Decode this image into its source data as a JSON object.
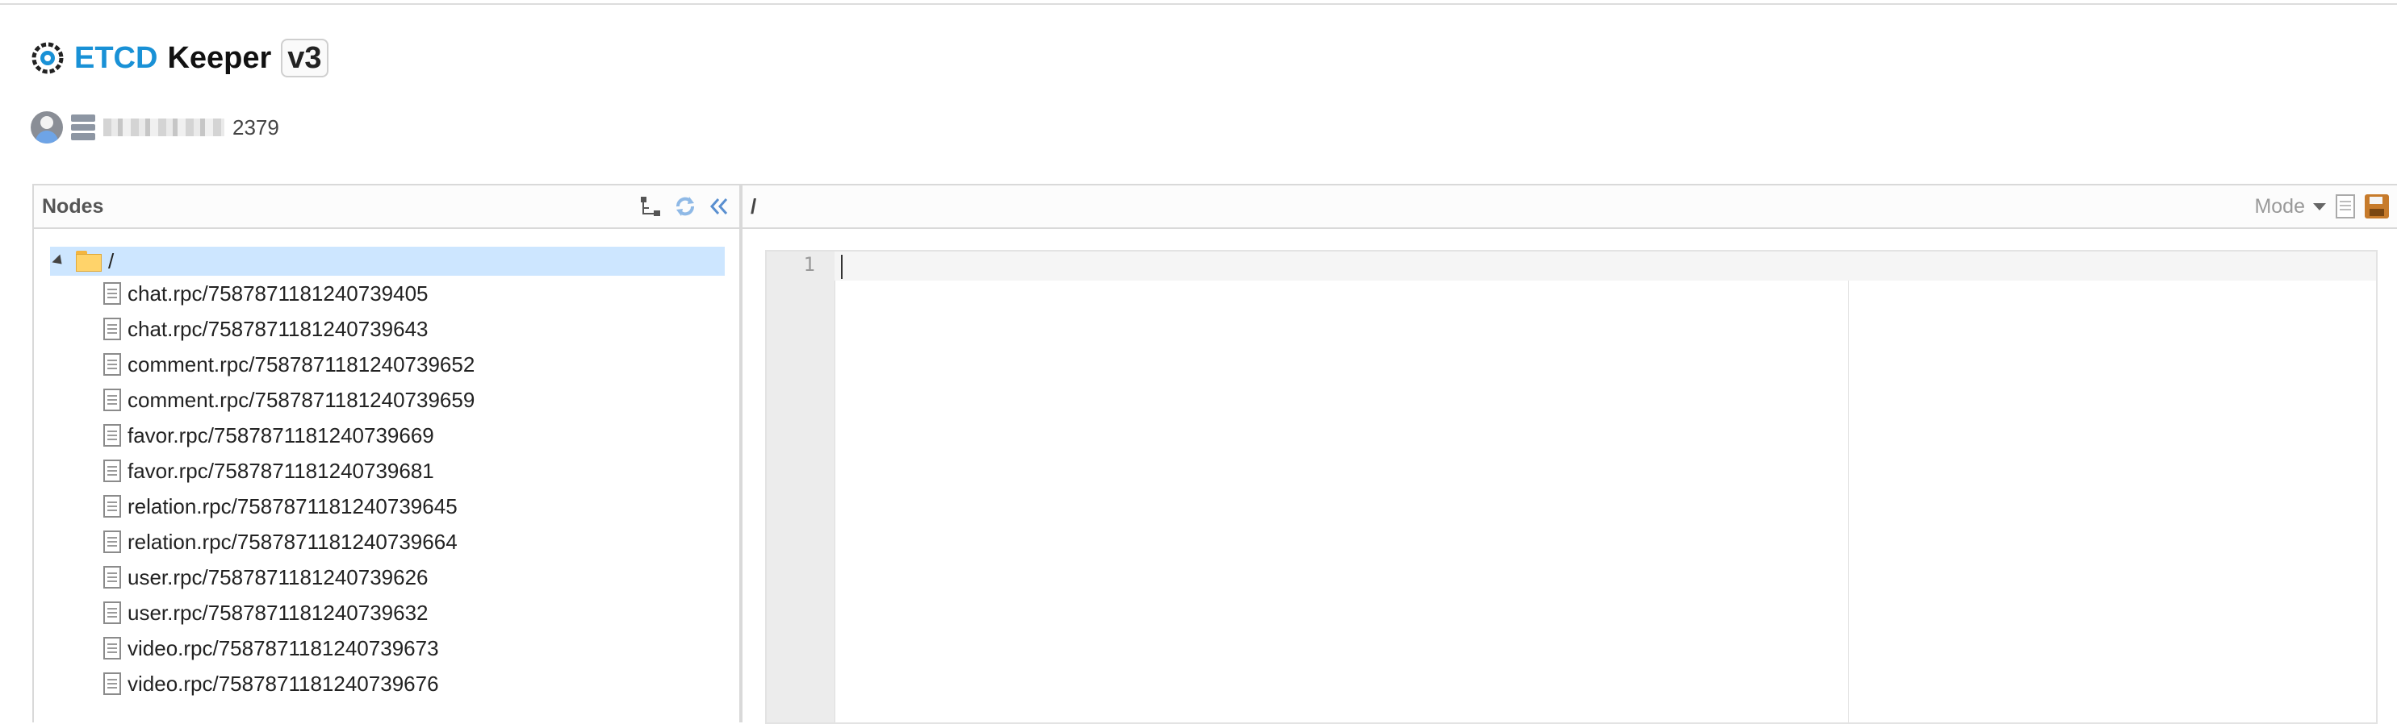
{
  "app": {
    "title_etcd": "ETCD",
    "title_keeper": "Keeper",
    "title_version": "v3"
  },
  "connection": {
    "address_suffix": "2379"
  },
  "nodes_panel": {
    "label": "Nodes",
    "root_label": "/",
    "items": [
      {
        "label": "chat.rpc/7587871181240739405"
      },
      {
        "label": "chat.rpc/7587871181240739643"
      },
      {
        "label": "comment.rpc/7587871181240739652"
      },
      {
        "label": "comment.rpc/7587871181240739659"
      },
      {
        "label": "favor.rpc/7587871181240739669"
      },
      {
        "label": "favor.rpc/7587871181240739681"
      },
      {
        "label": "relation.rpc/7587871181240739645"
      },
      {
        "label": "relation.rpc/7587871181240739664"
      },
      {
        "label": "user.rpc/7587871181240739626"
      },
      {
        "label": "user.rpc/7587871181240739632"
      },
      {
        "label": "video.rpc/7587871181240739673"
      },
      {
        "label": "video.rpc/7587871181240739676"
      }
    ]
  },
  "editor_panel": {
    "path": "/",
    "mode_label": "Mode",
    "line_number": "1"
  },
  "colors": {
    "accent": "#1991d6",
    "selection": "#cde6ff"
  }
}
